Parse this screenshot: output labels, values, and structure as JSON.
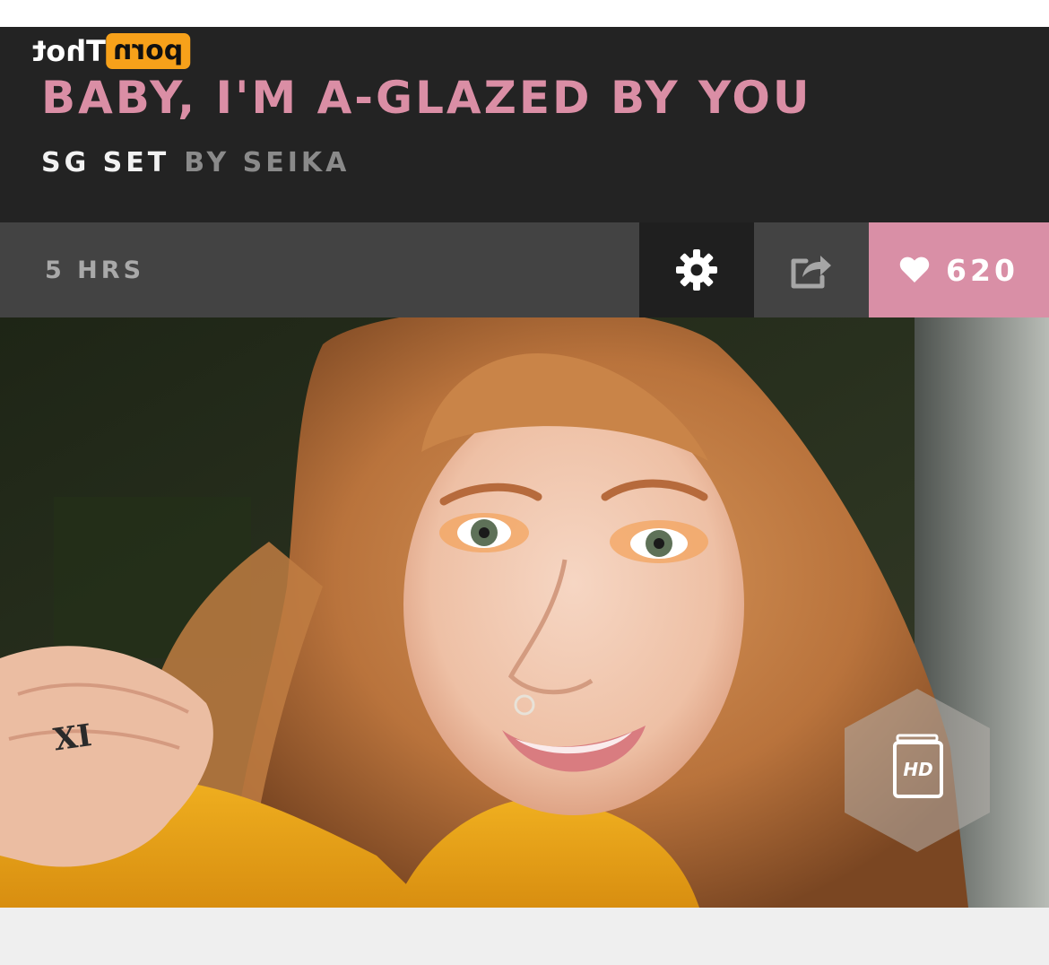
{
  "watermark": {
    "boxed_text": "porn",
    "text": "Thot"
  },
  "post": {
    "title": "BABY, I'M A-GLAZED BY YOU",
    "category": "SG SET",
    "author_line": "BY SEIKA"
  },
  "meta_bar": {
    "time_ago": "5 HRS",
    "settings_icon": "gear-icon",
    "share_icon": "share-icon",
    "like_icon": "heart-icon",
    "like_count": "620"
  },
  "media": {
    "badge_label": "HD",
    "badge_icon": "hd-badge-icon"
  },
  "colors": {
    "accent_pink": "#d98fa6",
    "title_pink": "#da8ea5",
    "header_bg": "#232323",
    "bar_bg": "#434343"
  }
}
